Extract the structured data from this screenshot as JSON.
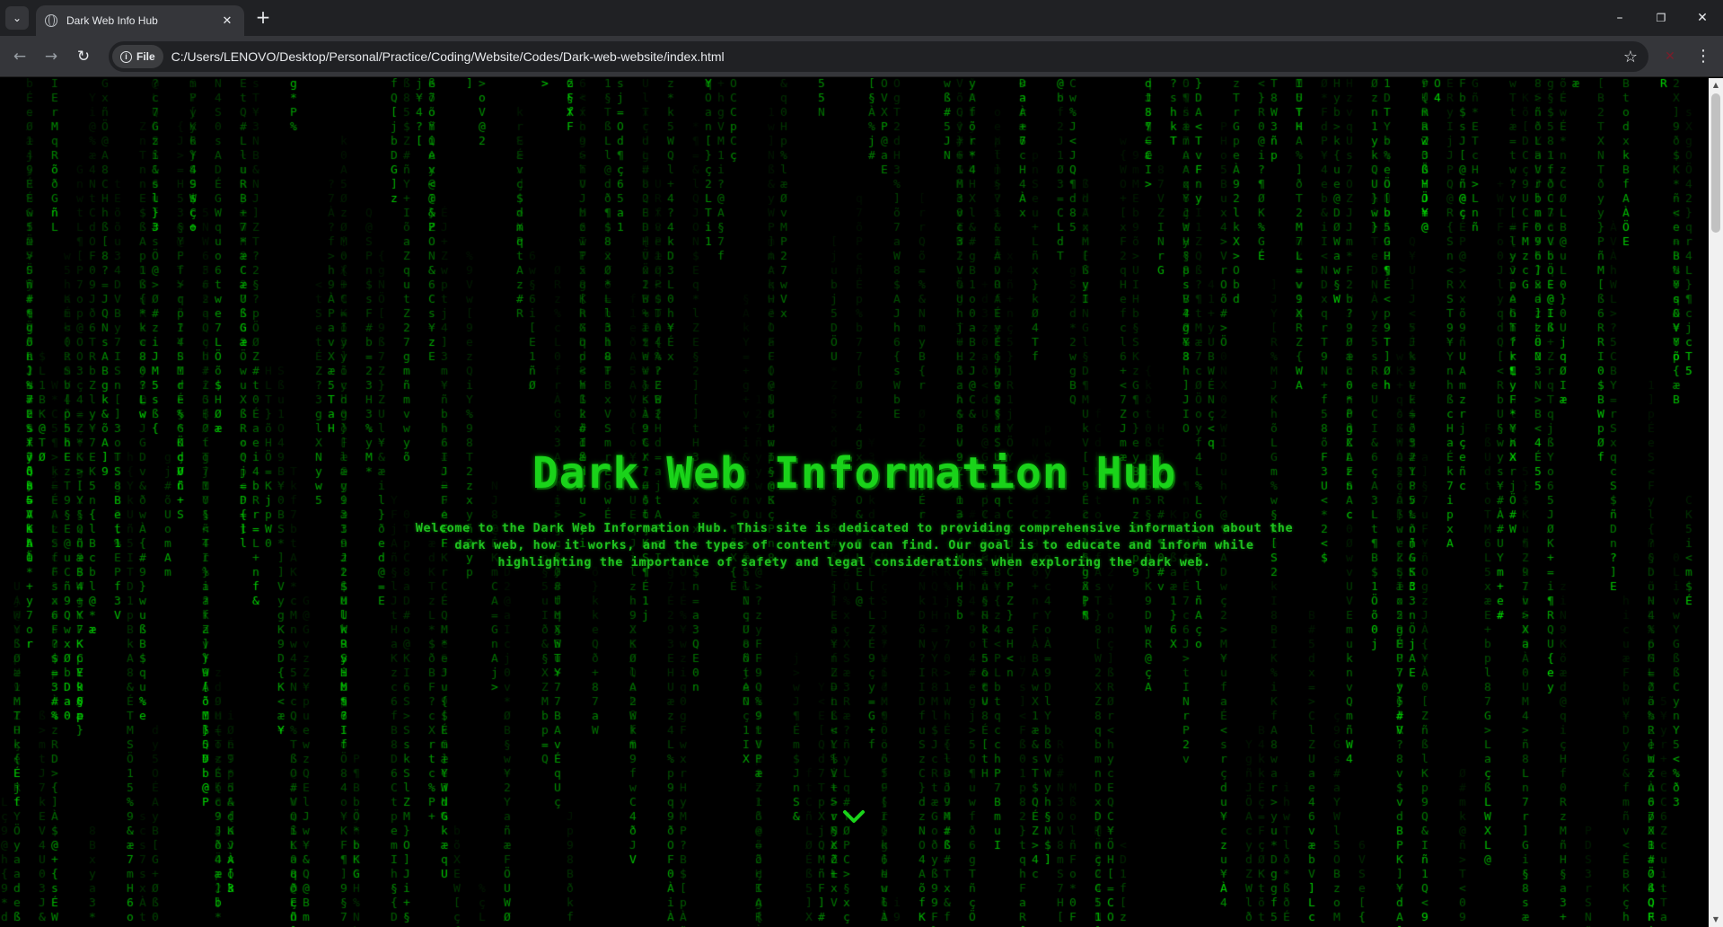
{
  "browser": {
    "tab_list_icon": "chevron-down-icon",
    "tab": {
      "title": "Dark Web Info Hub",
      "close_label": "✕"
    },
    "new_tab_label": "+",
    "window_controls": {
      "minimize": "–",
      "restore": "❐",
      "close": "✕"
    },
    "nav": {
      "back": "←",
      "forward": "→",
      "reload": "↻"
    },
    "address": {
      "chip_label": "File",
      "url": "C:/Users/LENOVO/Desktop/Personal/Practice/Coding/Website/Codes/Dark-web-website/index.html"
    },
    "bookmark_icon": "star-icon",
    "menu_icon": "more-vert-icon"
  },
  "page": {
    "title": "Dark Web Information Hub",
    "intro": "Welcome to the Dark Web Information Hub. This site is dedicated to providing comprehensive information about the dark web, how it works, and the types of content you can find. Our goal is to educate and inform while highlighting the importance of safety and legal considerations when exploring the dark web.",
    "scroll_icon": "chevron-down-icon",
    "colors": {
      "accent": "#1ad31a",
      "background": "#000000",
      "rain": "#00ff00"
    }
  }
}
